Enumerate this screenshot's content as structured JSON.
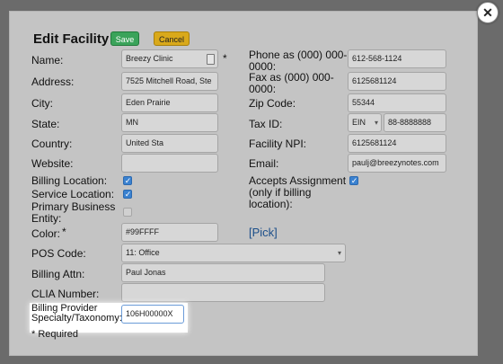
{
  "dialog": {
    "title": "Edit Facility",
    "save_label": "Save",
    "cancel_label": "Cancel",
    "close_icon": "close-icon"
  },
  "fields": {
    "name_label": "Name:",
    "name_value": "Breezy Clinic",
    "address_label": "Address:",
    "address_value": "7525 Mitchell Road, Ste",
    "city_label": "City:",
    "city_value": "Eden Prairie",
    "state_label": "State:",
    "state_value": "MN",
    "country_label": "Country:",
    "country_value": "United Sta",
    "website_label": "Website:",
    "website_value": "",
    "billing_location_label": "Billing Location:",
    "billing_location_checked": true,
    "service_location_label": "Service Location:",
    "service_location_checked": true,
    "primary_business_label": "Primary Business Entity:",
    "primary_business_checked": false,
    "color_label": "Color:",
    "color_value": "#99FFFF",
    "pick_label": "[Pick]",
    "pos_code_label": "POS Code:",
    "pos_code_value": "11: Office",
    "billing_attn_label": "Billing Attn:",
    "billing_attn_value": "Paul Jonas",
    "clia_label": "CLIA Number:",
    "clia_value": "",
    "taxonomy_label": "Billing Provider Specialty/Taxonomy:",
    "taxonomy_value": "106H00000X",
    "phone_label": "Phone as (000) 000-0000:",
    "phone_value": "612-568-1124",
    "fax_label": "Fax as (000) 000-0000:",
    "fax_value": "6125681124",
    "zip_label": "Zip Code:",
    "zip_value": "55344",
    "tax_id_label": "Tax ID:",
    "tax_id_type": "EIN",
    "tax_id_value": "88-8888888",
    "npi_label": "Facility NPI:",
    "npi_value": "6125681124",
    "email_label": "Email:",
    "email_value": "paulj@breezynotes.com",
    "accepts_label": "Accepts Assignment (only if billing location):",
    "accepts_checked": true
  },
  "required_note": "* Required",
  "required_star": "*"
}
